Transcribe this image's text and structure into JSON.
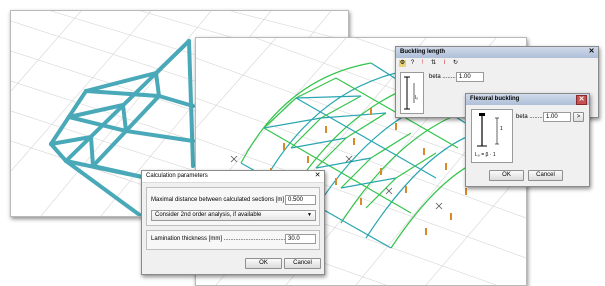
{
  "calc_dialog": {
    "title": "Calculation parameters",
    "max_distance_label": "Maximal distance between calculated sections [m] ......",
    "max_distance_value": "0.500",
    "analysis_option": "Consider 2nd order analysis, if available",
    "lamination_label": "Lamination thickness [mm] ........................................",
    "lamination_value": "30.0",
    "ok_label": "OK",
    "cancel_label": "Cancel"
  },
  "buckling_dialog": {
    "title": "Buckling length",
    "beta_label": "beta ........",
    "beta_value": "1.00",
    "diagram_label": "l₀"
  },
  "flexural_dialog": {
    "title": "Flexural buckling",
    "beta_label": "beta ........",
    "beta_value": "1.00",
    "more_label": ">",
    "diagram_top": "1",
    "formula": "L₀ = β · 1",
    "ok_label": "OK",
    "cancel_label": "Cancel"
  },
  "colors": {
    "truss_blue": "#4aa9b8",
    "grid_gray": "#d3d3d3",
    "dome_green": "#34c44c",
    "dome_teal": "#2aa6b0",
    "support_orange": "#d88a2a",
    "titlebar_blue": "#aebfd8",
    "close_red": "#c75050"
  },
  "icons": [
    "toolbar-settings-icon",
    "help-icon",
    "warning-icon",
    "align-icon",
    "column-icon",
    "refresh-icon",
    "close-icon",
    "dropdown-arrow-icon"
  ]
}
